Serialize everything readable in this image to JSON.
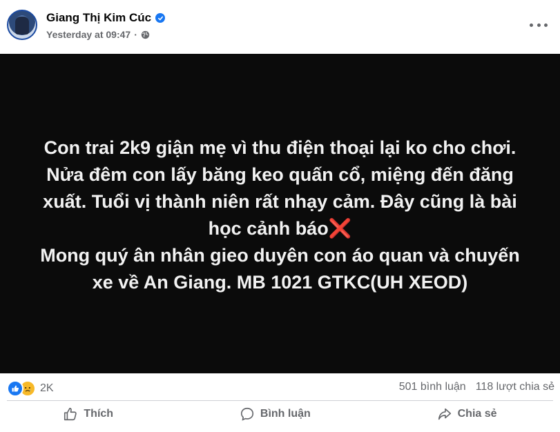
{
  "post": {
    "author_name": "Giang Thị Kim Cúc",
    "timestamp": "Yesterday at 09:47",
    "separator": "·",
    "privacy_icon": "globe-icon",
    "verified_icon": "verified-badge-icon",
    "more_icon": "more-options-icon"
  },
  "image_text": {
    "line1": "Con trai 2k9 giận mẹ vì thu điện thoại lại ko cho chơi.",
    "line2": "Nửa đêm con lấy băng keo quấn cổ, miệng đến đăng",
    "line3": "xuất. Tuổi vị thành niên rất nhạy cảm. Đây cũng là bài",
    "line4": "học cảnh báo",
    "x_emoji": "❌",
    "line5": "Mong quý ân nhân gieo duyên con áo quan và chuyến",
    "line6": "xe về An Giang. MB 1021 GTKC(UH XEOD)"
  },
  "reactions": {
    "icons": [
      "like-reaction-icon",
      "sad-reaction-icon"
    ],
    "count": "2K",
    "comments": "501 bình luận",
    "shares": "118 lượt chia sẻ"
  },
  "actions": {
    "like_label": "Thích",
    "comment_label": "Bình luận",
    "share_label": "Chia sẻ"
  },
  "colors": {
    "accent": "#1877f2",
    "secondary_text": "#65676b",
    "image_bg": "#0b0b0b",
    "x_mark": "#e0281f"
  }
}
